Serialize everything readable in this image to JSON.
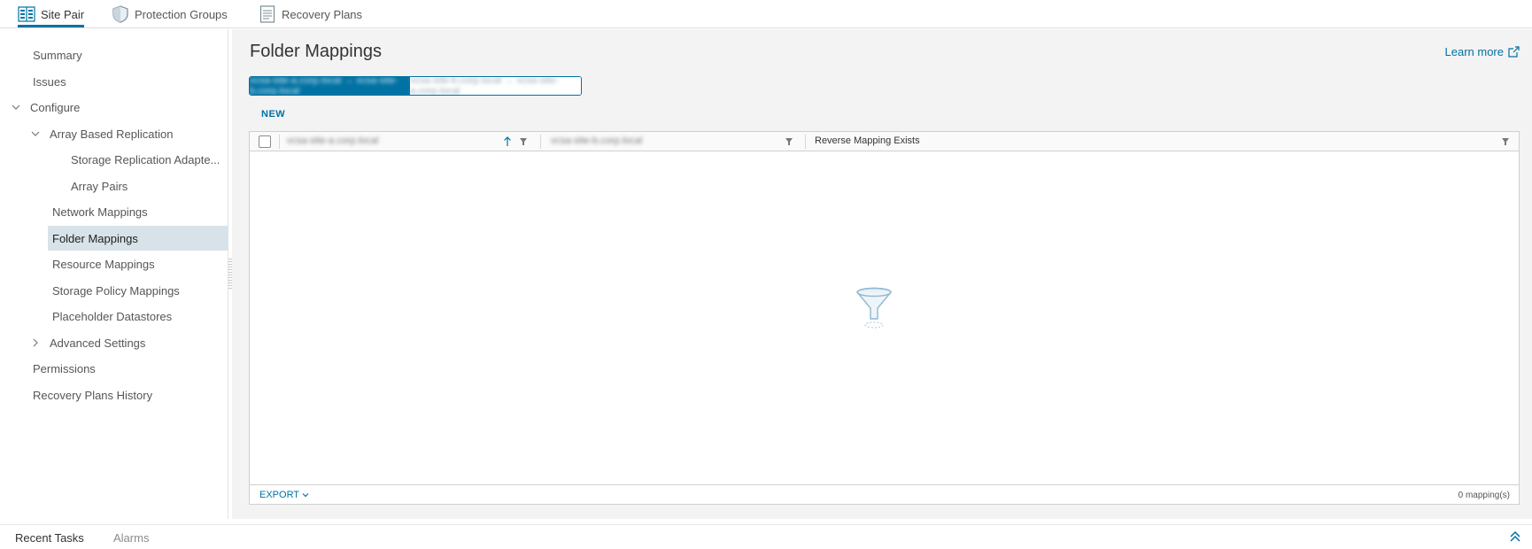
{
  "top_tabs": [
    {
      "label": "Site Pair",
      "icon": "site-pair-icon",
      "active": true
    },
    {
      "label": "Protection Groups",
      "icon": "shield-icon",
      "active": false
    },
    {
      "label": "Recovery Plans",
      "icon": "document-icon",
      "active": false
    }
  ],
  "nav": {
    "summary": "Summary",
    "issues": "Issues",
    "configure": "Configure",
    "array_based_replication": "Array Based Replication",
    "storage_replication_adapters": "Storage Replication Adapte...",
    "array_pairs": "Array Pairs",
    "network_mappings": "Network Mappings",
    "folder_mappings": "Folder Mappings",
    "resource_mappings": "Resource Mappings",
    "storage_policy_mappings": "Storage Policy Mappings",
    "placeholder_datastores": "Placeholder Datastores",
    "advanced_settings": "Advanced Settings",
    "permissions": "Permissions",
    "recovery_plans_history": "Recovery Plans History",
    "selected": "Folder Mappings"
  },
  "main": {
    "title": "Folder Mappings",
    "learn_more": "Learn more",
    "direction_toggle": {
      "left": "vcsa-site-a.corp.local → vcsa-site-b.corp.local",
      "right": "vcsa-site-b.corp.local → vcsa-site-a.corp.local"
    },
    "new_label": "NEW",
    "grid": {
      "columns": [
        {
          "label": "vcsa-site-a.corp.local",
          "sort": "ascending",
          "blurred": true
        },
        {
          "label": "vcsa-site-b.corp.local",
          "blurred": true
        },
        {
          "label": "Reverse Mapping Exists",
          "blurred": false
        }
      ],
      "rows": [],
      "empty_icon": "funnel-icon",
      "export_label": "EXPORT",
      "count_label": "0 mapping(s)"
    }
  },
  "bottom_tabs": [
    {
      "label": "Recent Tasks",
      "active": true
    },
    {
      "label": "Alarms",
      "active": false
    }
  ],
  "colors": {
    "accent": "#0072a3",
    "selected_nav": "#d8e3e9",
    "panel_bg": "#f3f3f3"
  }
}
